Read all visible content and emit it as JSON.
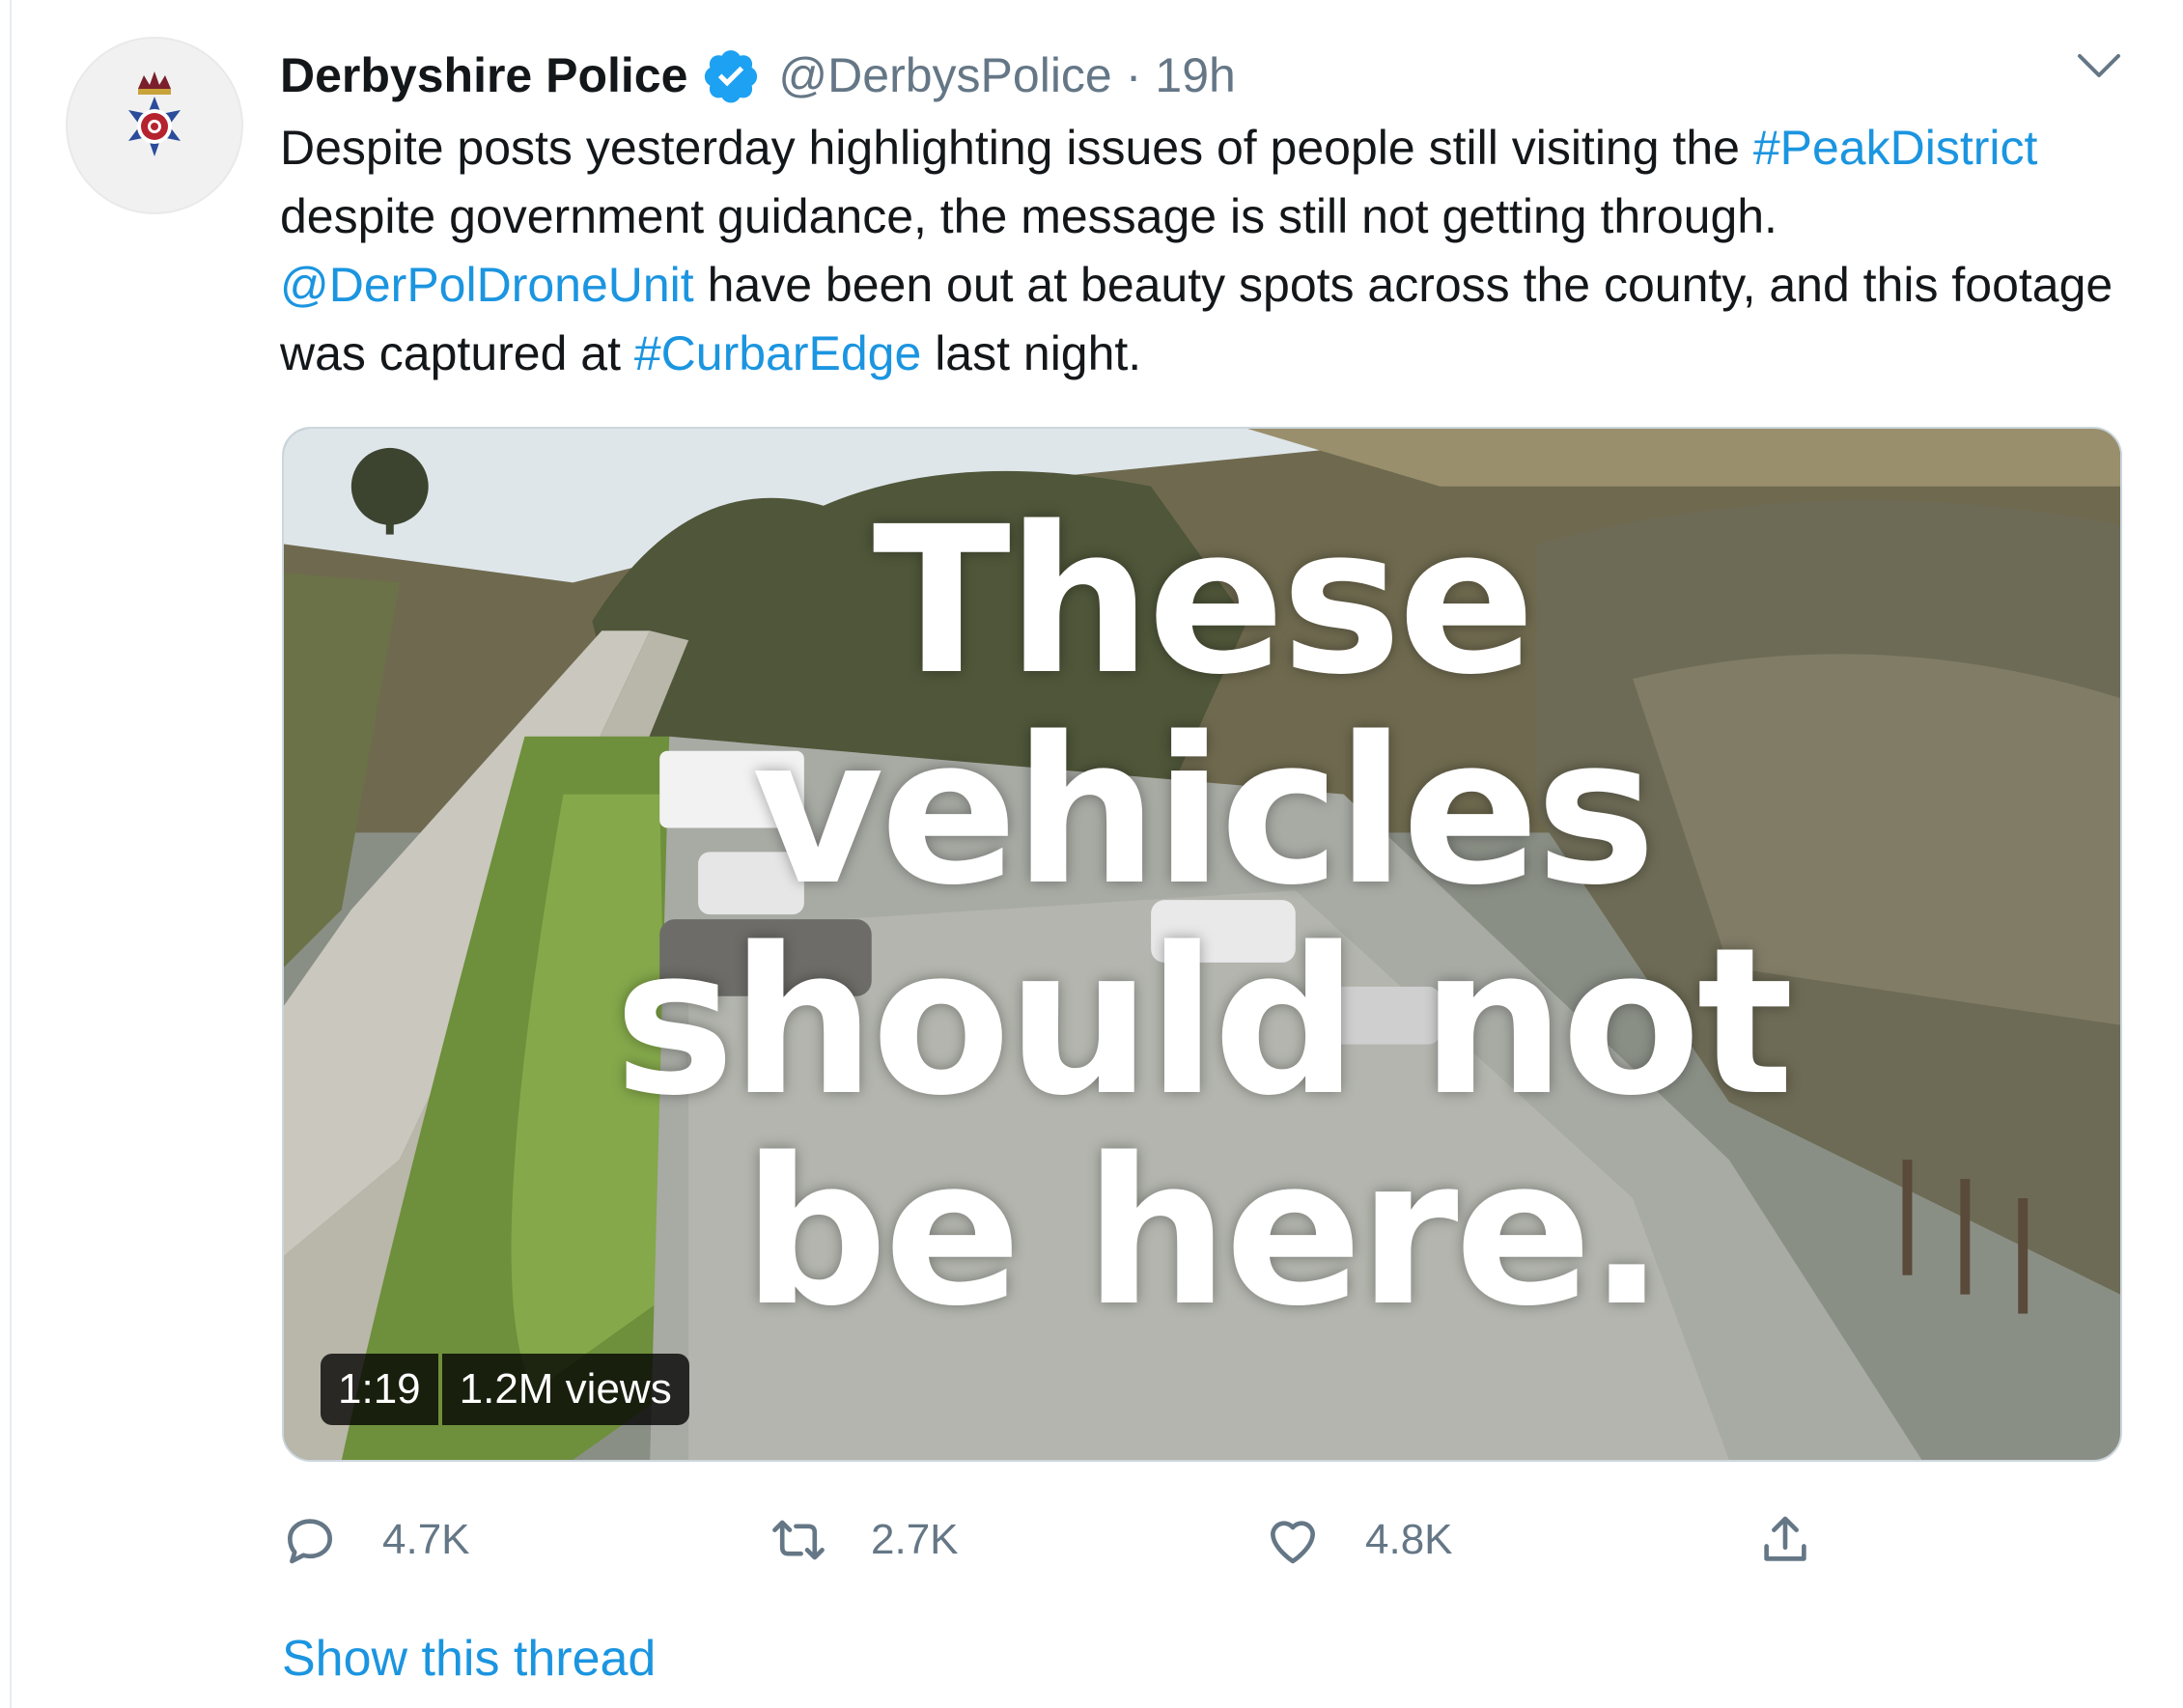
{
  "tweet": {
    "author": {
      "name": "Derbyshire Police",
      "handle": "@DerbysPolice",
      "separator": "·",
      "time": "19h",
      "verified": true
    },
    "text": {
      "t1": "Despite posts yesterday highlighting issues of people still visiting the ",
      "link1": "#PeakDistrict",
      "t2": " despite government guidance, the message is still not getting through. ",
      "link2": "@DerPolDroneUnit",
      "t3": " have been out at beauty spots across the county, and this footage was captured at ",
      "link3": "#CurbarEdge",
      "t4": " last night."
    },
    "media": {
      "overlay_lines": [
        "These",
        "vehicles",
        "should not",
        "be here."
      ],
      "duration": "1:19",
      "views": "1.2M views"
    },
    "actions": {
      "reply_count": "4.7K",
      "retweet_count": "2.7K",
      "like_count": "4.8K"
    },
    "show_thread": "Show this thread"
  },
  "colors": {
    "link": "#1b95e0",
    "verified": "#1da1f2",
    "secondary_text": "#657786"
  },
  "icons": [
    "police-crest-icon",
    "verified-badge-icon",
    "chevron-down-icon",
    "reply-icon",
    "retweet-icon",
    "like-icon",
    "share-icon"
  ]
}
